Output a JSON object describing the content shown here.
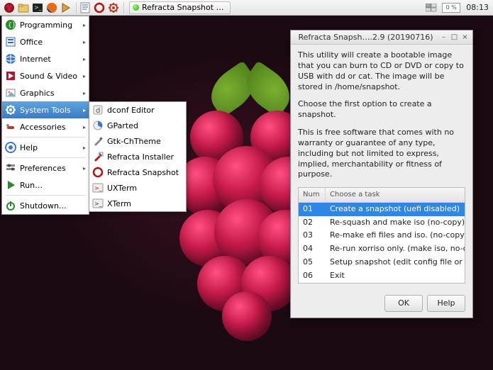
{
  "taskbar": {
    "task_label": "Refracta Snapshot …",
    "cpu": "0 %",
    "clock": "08:13"
  },
  "menu": {
    "items": [
      {
        "label": "Programming",
        "icon": "programming-icon",
        "arrow": true
      },
      {
        "label": "Office",
        "icon": "office-icon",
        "arrow": true
      },
      {
        "label": "Internet",
        "icon": "internet-icon",
        "arrow": true
      },
      {
        "label": "Sound & Video",
        "icon": "sound-video-icon",
        "arrow": true
      },
      {
        "label": "Graphics",
        "icon": "graphics-icon",
        "arrow": true
      },
      {
        "label": "System Tools",
        "icon": "system-tools-icon",
        "arrow": true,
        "highlight": true
      },
      {
        "label": "Accessories",
        "icon": "accessories-icon",
        "arrow": true
      },
      {
        "sep": true
      },
      {
        "label": "Help",
        "icon": "help-icon",
        "arrow": true
      },
      {
        "sep": true
      },
      {
        "label": "Preferences",
        "icon": "preferences-icon",
        "arrow": true
      },
      {
        "label": "Run…",
        "icon": "run-icon",
        "arrow": false
      },
      {
        "sep": true
      },
      {
        "label": "Shutdown…",
        "icon": "shutdown-icon",
        "arrow": false
      }
    ]
  },
  "submenu": {
    "items": [
      {
        "label": "dconf Editor",
        "icon": "dconf-editor-icon"
      },
      {
        "label": "GParted",
        "icon": "gparted-icon"
      },
      {
        "label": "Gtk-ChTheme",
        "icon": "gtk-chtheme-icon"
      },
      {
        "label": "Refracta Installer",
        "icon": "refracta-installer-icon"
      },
      {
        "label": "Refracta Snapshot",
        "icon": "refracta-snapshot-icon"
      },
      {
        "label": "UXTerm",
        "icon": "uxterm-icon"
      },
      {
        "label": "XTerm",
        "icon": "xterm-icon"
      }
    ]
  },
  "dialog": {
    "title": "Refracta Snapsh….2.9 (20190716)",
    "para1": "This utility will create a bootable image that you can burn to CD or DVD or copy to USB with dd or cat. The image will be stored in /home/snapshot.",
    "para2": "Choose the first option to create a snapshot.",
    "para3": "This is free software that comes with no warranty or guarantee of any type, including but not limited to express, implied, merchantability or fitness of purpose.",
    "columns": {
      "num": "Num",
      "task": "Choose a task"
    },
    "tasks": [
      {
        "num": "01",
        "label": "Create a snapshot (uefi disabled)",
        "selected": true
      },
      {
        "num": "02",
        "label": "Re-squash and make iso (no-copy)"
      },
      {
        "num": "03",
        "label": "Re-make efi files and iso. (no-copy) (uefi disabled)"
      },
      {
        "num": "04",
        "label": "Re-run xorriso only. (make iso, no-copy, no-squash)"
      },
      {
        "num": "05",
        "label": "Setup snapshot (edit config file or exclude list)"
      },
      {
        "num": "06",
        "label": "Exit"
      }
    ],
    "buttons": {
      "ok": "OK",
      "help": "Help"
    }
  }
}
